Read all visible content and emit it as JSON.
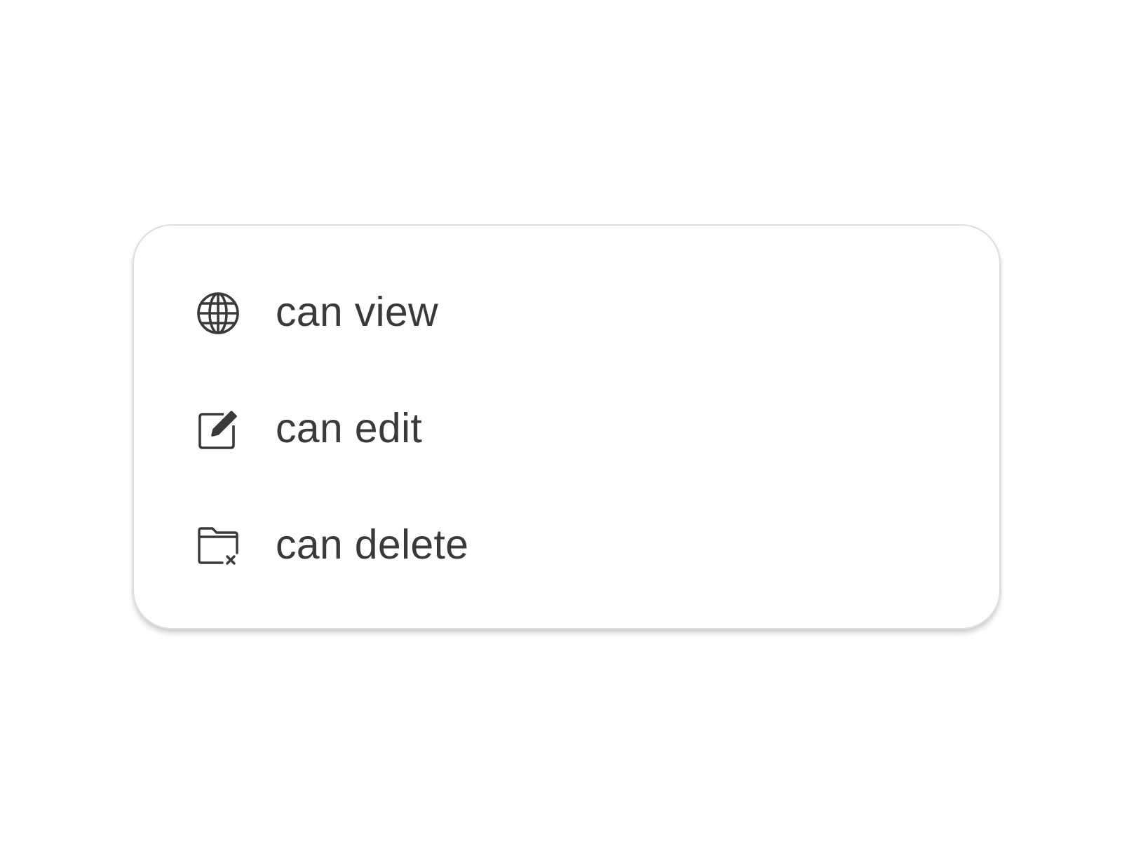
{
  "menu": {
    "items": [
      {
        "icon": "globe-icon",
        "label": "can view"
      },
      {
        "icon": "edit-icon",
        "label": "can edit"
      },
      {
        "icon": "folder-delete-icon",
        "label": "can delete"
      }
    ]
  },
  "colors": {
    "text": "#3a3a3a",
    "icon": "#3a3a3a",
    "border": "#dedede",
    "background": "#ffffff"
  }
}
